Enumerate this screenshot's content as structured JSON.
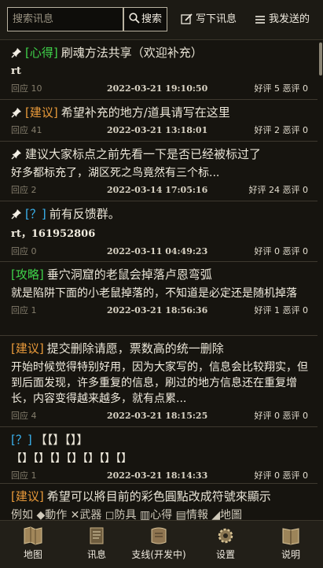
{
  "search": {
    "placeholder": "搜索讯息",
    "button": "搜索"
  },
  "toolbar": {
    "write": "写下讯息",
    "sent": "我发送的"
  },
  "posts": [
    {
      "tag": "[心得]",
      "title": "刷魂方法共享（欢迎补充）",
      "body": "rt",
      "replies": "回应 10",
      "date": "2022-03-21 19:10:50",
      "rating": "好评 5 恶评 0"
    },
    {
      "tag": "[建议]",
      "title": "希望补充的地方/道具请写在这里",
      "body": "",
      "replies": "回应 41",
      "date": "2022-03-21 13:18:01",
      "rating": "好评 2 恶评 0"
    },
    {
      "tag": "",
      "title": "建议大家标点之前先看一下是否已经被标过了",
      "body": "好多都标充了，湖区死之鸟竟然有三个标...",
      "replies": "回应 2",
      "date": "2022-03-14 17:05:16",
      "rating": "好评 24 恶评 0"
    },
    {
      "tag": "[？]",
      "title": "前有反馈群。",
      "body": "rt，161952806",
      "replies": "回应 0",
      "date": "2022-03-11 04:49:23",
      "rating": "好评 0 恶评 0"
    },
    {
      "tag": "[攻略]",
      "title": "垂穴洞窟的老鼠会掉落卢恩弯弧",
      "body": "就是陷阱下面的小老鼠掉落的，不知道是必定还是随机掉落",
      "replies": "回应 1",
      "date": "2022-03-21 18:56:36",
      "rating": "好评 1 恶评 0"
    },
    {
      "tag": "[建议]",
      "title": "提交删除请愿，票数高的统一删除",
      "body": "开始时候觉得特别好用，因为大家写的，信息会比较翔实，但到后面发现，许多重复的信息，刷过的地方信息还在重复增长，内容变得越来越多，就有点累...",
      "replies": "回应 4",
      "date": "2022-03-21 18:15:25",
      "rating": "好评 0 恶评 0"
    },
    {
      "tag": "[？]",
      "title": "【【】【】】",
      "body": "【】【】【】【】【】【】【】",
      "replies": "回应 1",
      "date": "2022-03-21 18:14:33",
      "rating": "好评 0 恶评 0"
    },
    {
      "tag": "[建议]",
      "title": "希望可以將目前的彩色圓點改成符號來顯示",
      "body": "例如 ◆動作 ✕武器 ◻防具 ▥心得 ▤情報 ◢地圖",
      "replies": "",
      "date": "",
      "rating": ""
    }
  ],
  "nav": [
    {
      "label": "地图",
      "icon": "map-scroll-icon"
    },
    {
      "label": "讯息",
      "icon": "message-scroll-icon"
    },
    {
      "label": "支线(开发中)",
      "icon": "quest-scroll-icon"
    },
    {
      "label": "设置",
      "icon": "gear-icon"
    },
    {
      "label": "说明",
      "icon": "book-icon"
    }
  ],
  "colors": {
    "background": "#16140f",
    "tag_green": "#3fd24a",
    "tag_orange": "#e99a3a",
    "tag_blue": "#3ab3f0"
  }
}
